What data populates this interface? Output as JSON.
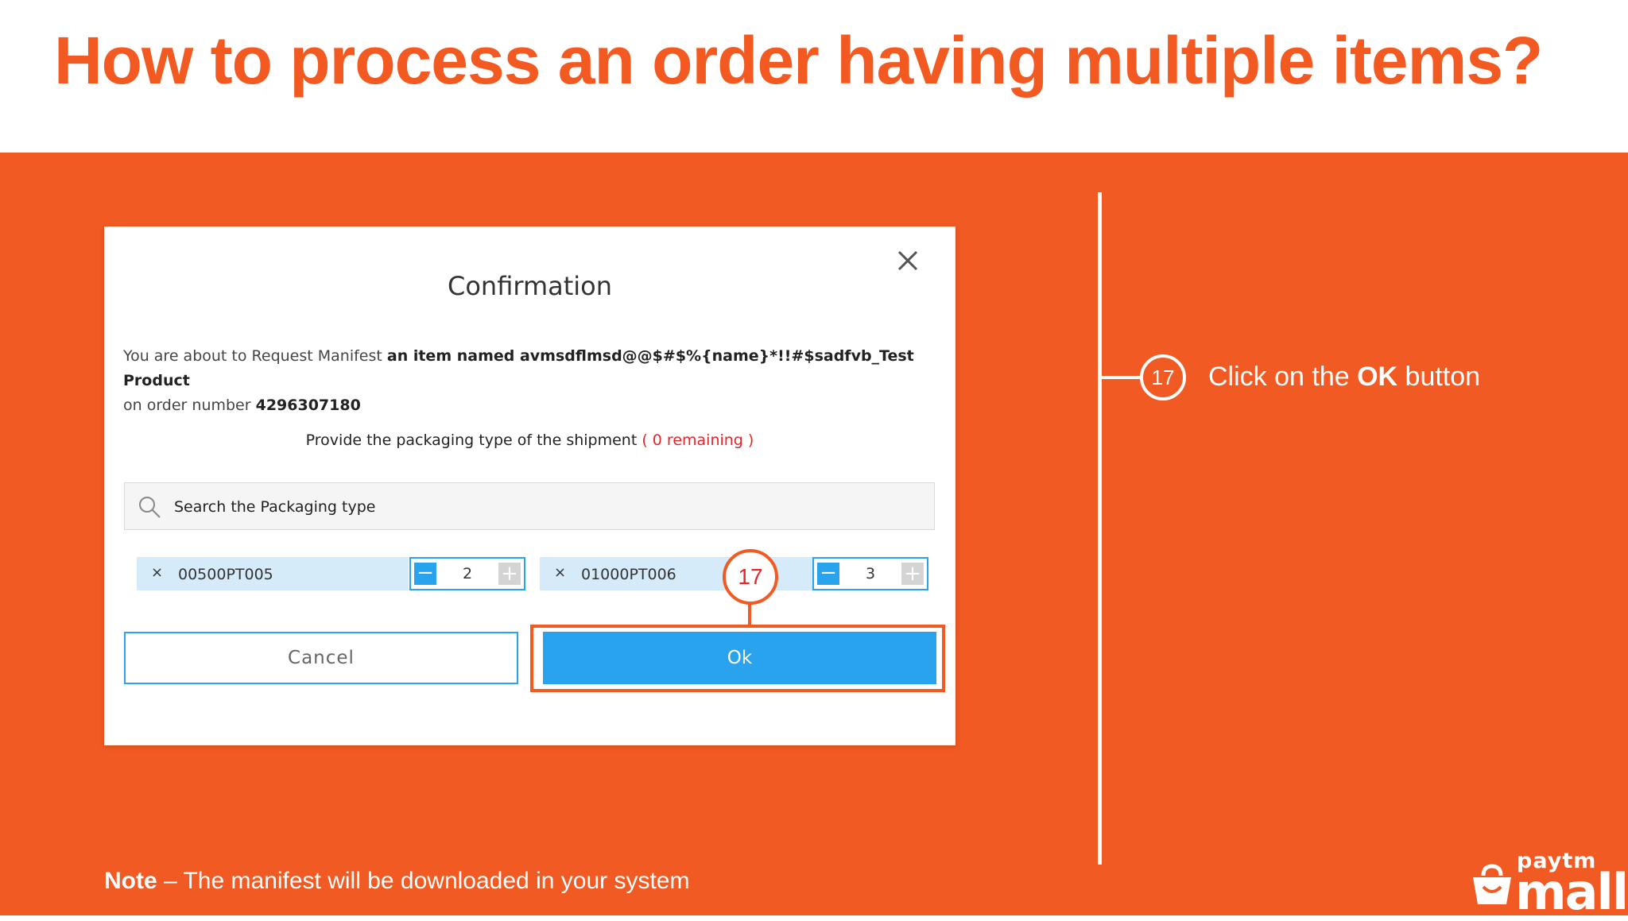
{
  "slide": {
    "title": "How to process an order having multiple items?"
  },
  "dialog": {
    "title": "Confirmation",
    "message_prefix": "You are about to Request Manifest ",
    "message_item": "an item named avmsdflmsd@@$#$%{name}*!!#$sadfvb_Test Product",
    "message_order_prefix": "on order number ",
    "order_number": "4296307180",
    "packaging_prompt": "Provide the packaging type of the shipment ",
    "remaining": "( 0 remaining )",
    "search_placeholder": "Search the Packaging type",
    "packaging_items": [
      {
        "remove": "×",
        "code": "00500PT005",
        "qty": "2",
        "minus": "−",
        "plus": "+"
      },
      {
        "remove": "×",
        "code": "01000PT006",
        "qty": "3",
        "minus": "−",
        "plus": "+"
      }
    ],
    "cancel_label": "Cancel",
    "ok_label": "Ok",
    "step_marker": "17"
  },
  "instruction": {
    "step": "17",
    "text_prefix": "Click on the ",
    "text_bold": "OK",
    "text_suffix": " button"
  },
  "note": {
    "label": "Note",
    "text": " – The manifest will be downloaded in your system"
  },
  "logo": {
    "line1": "paytm",
    "line2": "mall"
  },
  "colors": {
    "brand_orange": "#f15a22",
    "accent_blue": "#2aa3ee",
    "remaining_red": "#e6252a",
    "chip_bg": "#d6ebfa"
  }
}
